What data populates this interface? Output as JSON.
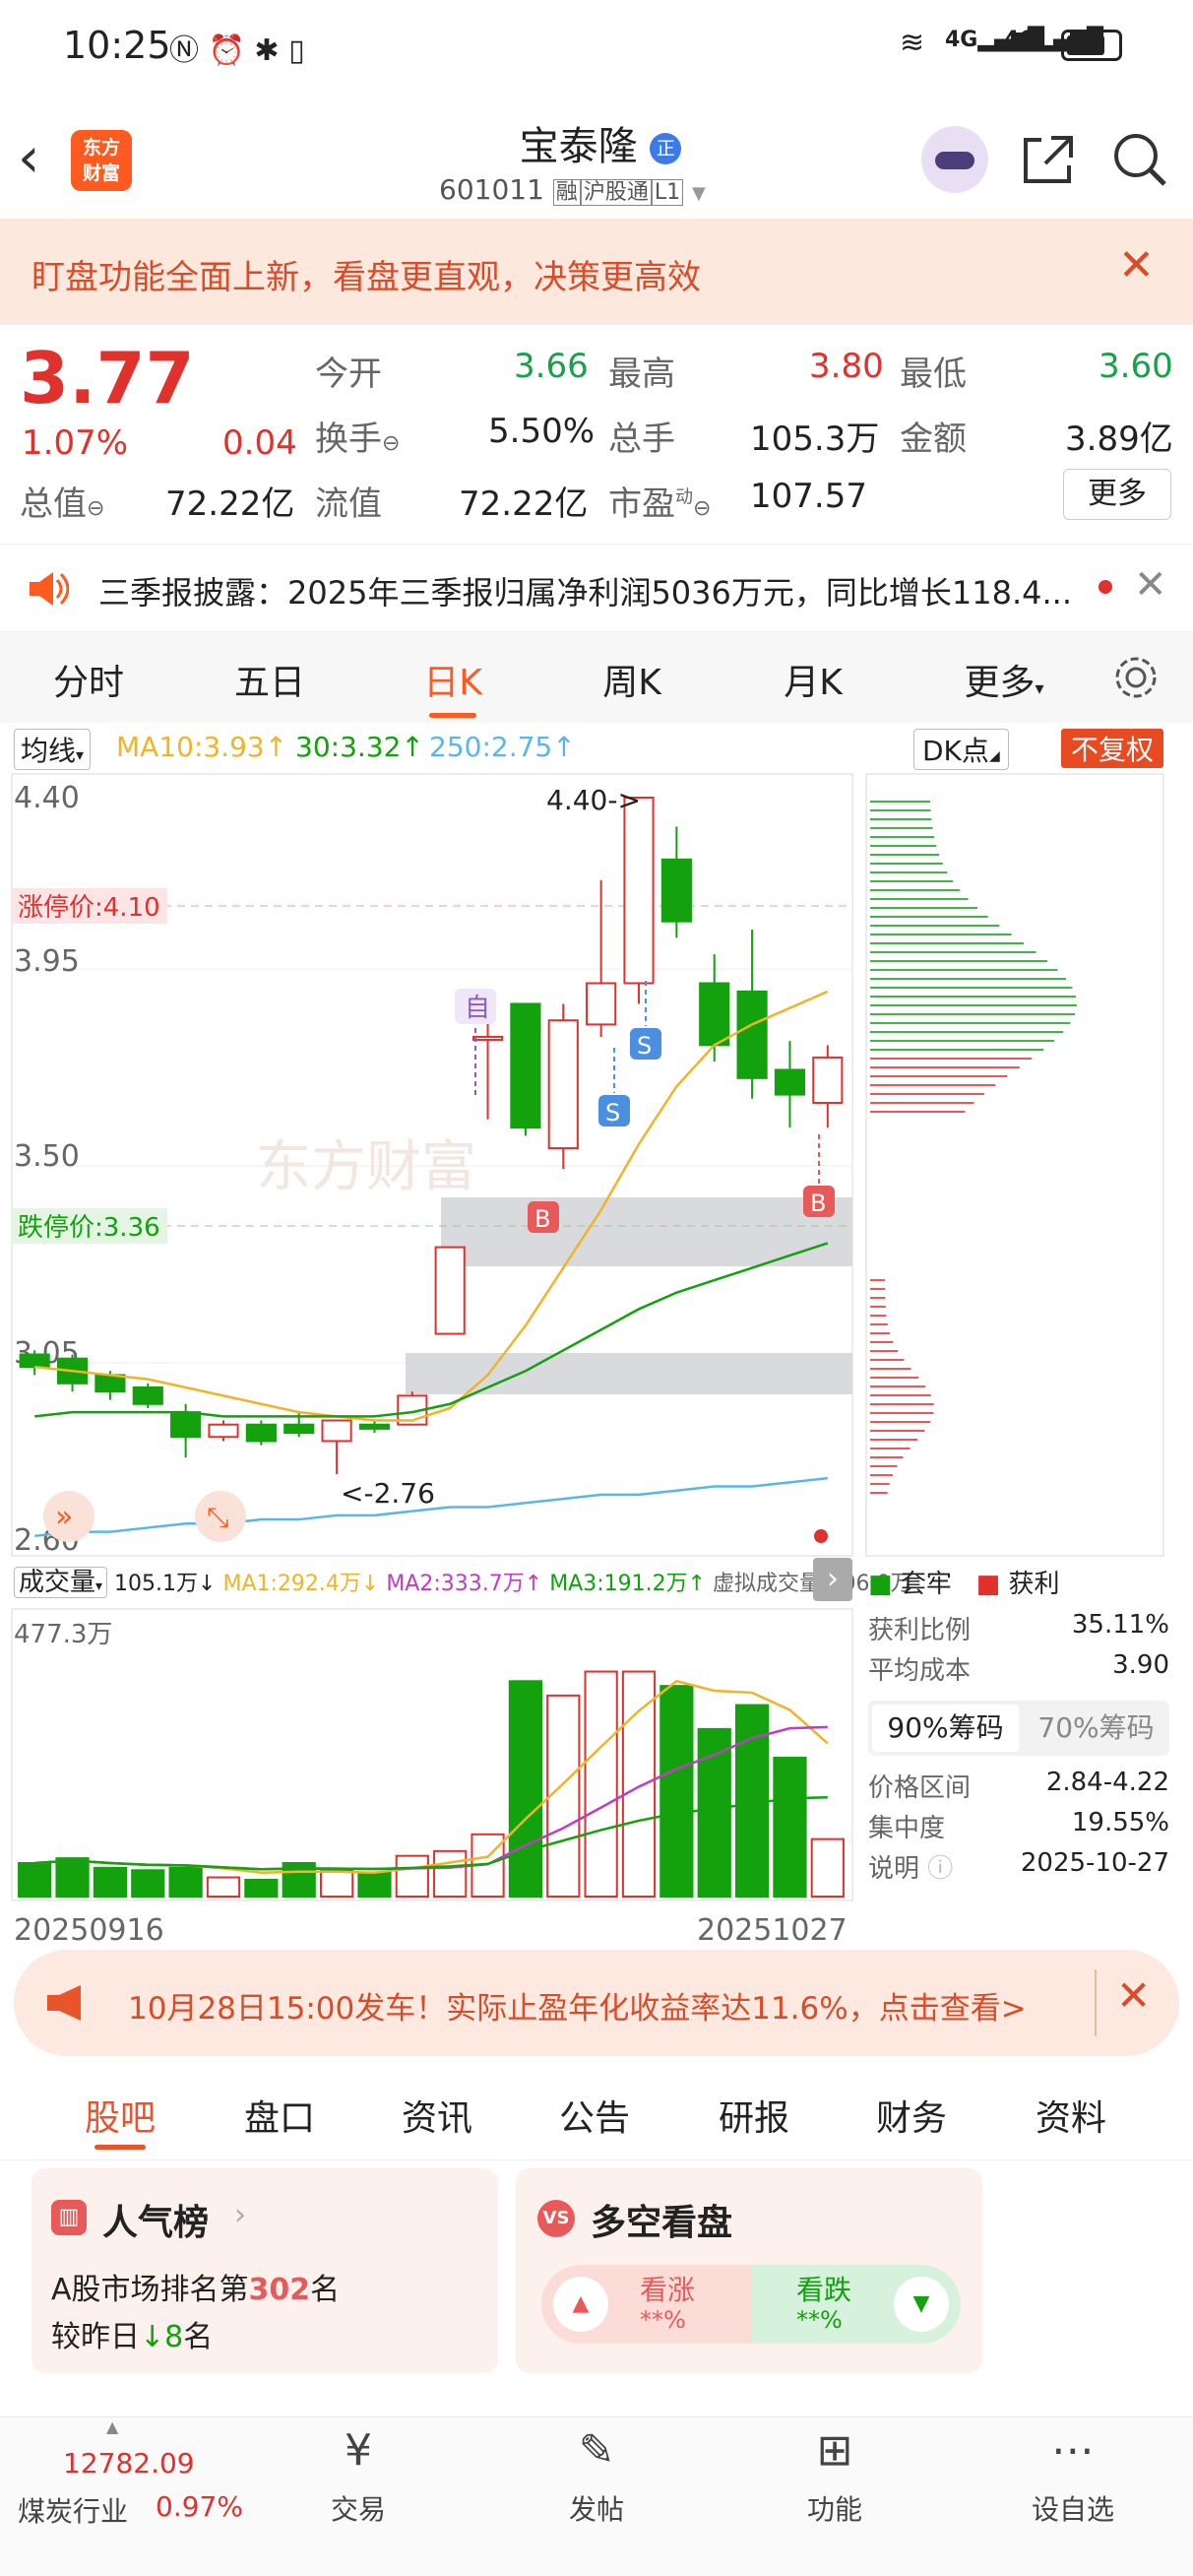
{
  "status": {
    "time": "10:25",
    "net1": "4G",
    "net2": "4G"
  },
  "header": {
    "logo_line1": "东方",
    "logo_line2": "财富",
    "name": "宝泰隆",
    "badge": "正",
    "code": "601011",
    "tag1": "融",
    "tag2": "沪股通",
    "tag3": "L1"
  },
  "banner": {
    "text": "盯盘功能全面上新，看盘更直观，决策更高效"
  },
  "quote": {
    "price": "3.77",
    "pct": "1.07%",
    "chg": "0.04",
    "open_label": "今开",
    "open": "3.66",
    "high_label": "最高",
    "high": "3.80",
    "low_label": "最低",
    "low": "3.60",
    "turnover_label": "换手",
    "turnover": "5.50%",
    "volume_label": "总手",
    "volume": "105.3万",
    "amount_label": "金额",
    "amount": "3.89亿",
    "mktcap_label": "总值",
    "mktcap": "72.22亿",
    "float_label": "流值",
    "float": "72.22亿",
    "pe_label": "市盈",
    "pe_sup": "动",
    "pe": "107.57",
    "more": "更多"
  },
  "notice": {
    "text": "三季报披露：2025年三季报归属净利润5036万元，同比增长118.4..."
  },
  "tabs": [
    "分时",
    "五日",
    "日K",
    "周K",
    "月K",
    "更多"
  ],
  "active_tab": "日K",
  "chart": {
    "ma_select": "均线",
    "ma10": "MA10:3.93↑",
    "ma30": "30:3.32↑",
    "ma250": "250:2.75↑",
    "dk": "DK点",
    "fq": "不复权",
    "limit_up": "涨停价:4.10",
    "limit_down": "跌停价:3.36",
    "high_note": "4.40->",
    "low_note": "<-2.76",
    "watermark": "东方财富",
    "zi_label": "自",
    "vol_select": "成交量",
    "vol_now": "105.1万↓",
    "vol_ma1": "MA1:292.4万↓",
    "vol_ma2": "MA2:333.7万↑",
    "vol_ma3": "MA3:191.2万↑",
    "vol_virtual": "虚拟成交量:206.0万",
    "vol_max": "477.3万",
    "date_start": "20250916",
    "date_end": "20251027"
  },
  "chart_data": {
    "type": "candlestick",
    "y_ticks": [
      "4.40",
      "3.95",
      "3.50",
      "3.05",
      "2.60"
    ],
    "ylim": [
      2.6,
      4.4
    ],
    "x_start": "20250916",
    "x_end": "20251027",
    "candles": [
      {
        "o": 3.05,
        "c": 3.02,
        "h": 3.06,
        "l": 3.0
      },
      {
        "o": 3.04,
        "c": 2.98,
        "h": 3.05,
        "l": 2.96
      },
      {
        "o": 3.0,
        "c": 2.96,
        "h": 3.01,
        "l": 2.94
      },
      {
        "o": 2.97,
        "c": 2.93,
        "h": 2.98,
        "l": 2.92
      },
      {
        "o": 2.91,
        "c": 2.85,
        "h": 2.93,
        "l": 2.8
      },
      {
        "o": 2.85,
        "c": 2.88,
        "h": 2.89,
        "l": 2.84
      },
      {
        "o": 2.88,
        "c": 2.84,
        "h": 2.89,
        "l": 2.83
      },
      {
        "o": 2.88,
        "c": 2.86,
        "h": 2.91,
        "l": 2.85
      },
      {
        "o": 2.84,
        "c": 2.89,
        "h": 2.89,
        "l": 2.76
      },
      {
        "o": 2.88,
        "c": 2.87,
        "h": 2.89,
        "l": 2.86
      },
      {
        "o": 2.88,
        "c": 2.95,
        "h": 2.96,
        "l": 2.88
      },
      {
        "o": 3.1,
        "c": 3.31,
        "h": 3.31,
        "l": 3.1
      },
      {
        "o": 3.82,
        "c": 3.82,
        "h": 3.9,
        "l": 3.62
      },
      {
        "o": 3.9,
        "c": 3.6,
        "h": 3.9,
        "l": 3.58
      },
      {
        "o": 3.55,
        "c": 3.86,
        "h": 3.9,
        "l": 3.5
      },
      {
        "o": 3.85,
        "c": 3.95,
        "h": 4.2,
        "l": 3.82
      },
      {
        "o": 3.95,
        "c": 4.4,
        "h": 4.4,
        "l": 3.9
      },
      {
        "o": 4.25,
        "c": 4.1,
        "h": 4.33,
        "l": 4.06
      },
      {
        "o": 3.95,
        "c": 3.8,
        "h": 4.02,
        "l": 3.76
      },
      {
        "o": 3.93,
        "c": 3.72,
        "h": 4.08,
        "l": 3.67
      },
      {
        "o": 3.74,
        "c": 3.68,
        "h": 3.81,
        "l": 3.6
      },
      {
        "o": 3.66,
        "c": 3.77,
        "h": 3.8,
        "l": 3.6
      }
    ],
    "ma10": [
      3.02,
      3.01,
      3.0,
      2.99,
      2.97,
      2.95,
      2.93,
      2.91,
      2.9,
      2.89,
      2.89,
      2.92,
      3.0,
      3.12,
      3.26,
      3.4,
      3.56,
      3.7,
      3.8,
      3.85,
      3.89,
      3.93
    ],
    "ma30": [
      2.9,
      2.91,
      2.91,
      2.91,
      2.91,
      2.9,
      2.9,
      2.9,
      2.9,
      2.9,
      2.91,
      2.93,
      2.97,
      3.01,
      3.06,
      3.11,
      3.16,
      3.2,
      3.23,
      3.26,
      3.29,
      3.32
    ],
    "ma250": [
      2.61,
      2.62,
      2.62,
      2.63,
      2.64,
      2.64,
      2.65,
      2.65,
      2.66,
      2.66,
      2.67,
      2.68,
      2.68,
      2.69,
      2.7,
      2.71,
      2.71,
      2.72,
      2.73,
      2.73,
      2.74,
      2.75
    ],
    "volume": [
      70,
      80,
      60,
      55,
      60,
      40,
      35,
      70,
      55,
      50,
      85,
      95,
      130,
      450,
      420,
      470,
      470,
      440,
      350,
      400,
      290,
      120
    ],
    "ylim_vol": [
      0,
      477.3
    ],
    "chip_stats": {
      "legend1": "套牢",
      "legend2": "获利",
      "profit_ratio_label": "获利比例",
      "profit_ratio": "35.11%",
      "avg_cost_label": "平均成本",
      "avg_cost": "3.90",
      "tab90": "90%筹码",
      "tab70": "70%筹码",
      "range_label": "价格区间",
      "range": "2.84-4.22",
      "conc_label": "集中度",
      "conc": "19.55%",
      "note_label": "说明",
      "note_date": "2025-10-27"
    }
  },
  "ad": {
    "text": "10月28日15:00发车！实际止盈年化收益率达11.6%，点击查看>"
  },
  "subtabs": [
    "股吧",
    "盘口",
    "资讯",
    "公告",
    "研报",
    "财务",
    "资料"
  ],
  "cards": {
    "pop_title": "人气榜",
    "pop_line1_pre": "A股市场排名第",
    "pop_rank": "302",
    "pop_line1_post": "名",
    "pop_line2_pre": "较昨日",
    "pop_change": "8",
    "pop_line2_post": "名",
    "ls_title": "多空看盘",
    "up_label": "看涨",
    "up_val": "**%",
    "down_label": "看跌",
    "down_val": "**%"
  },
  "bottom": {
    "index_val": "12782.09",
    "industry": "煤炭行业",
    "industry_pct": "0.97%",
    "nav1": "交易",
    "nav2": "发帖",
    "nav3": "功能",
    "nav4": "设自选"
  },
  "colors": {
    "up": "#e0312d",
    "down": "#13a10e",
    "ma10": "#f0b429",
    "ma30": "#13a10e",
    "ma250": "#5bb5e8",
    "accent": "#ff5a1f"
  }
}
